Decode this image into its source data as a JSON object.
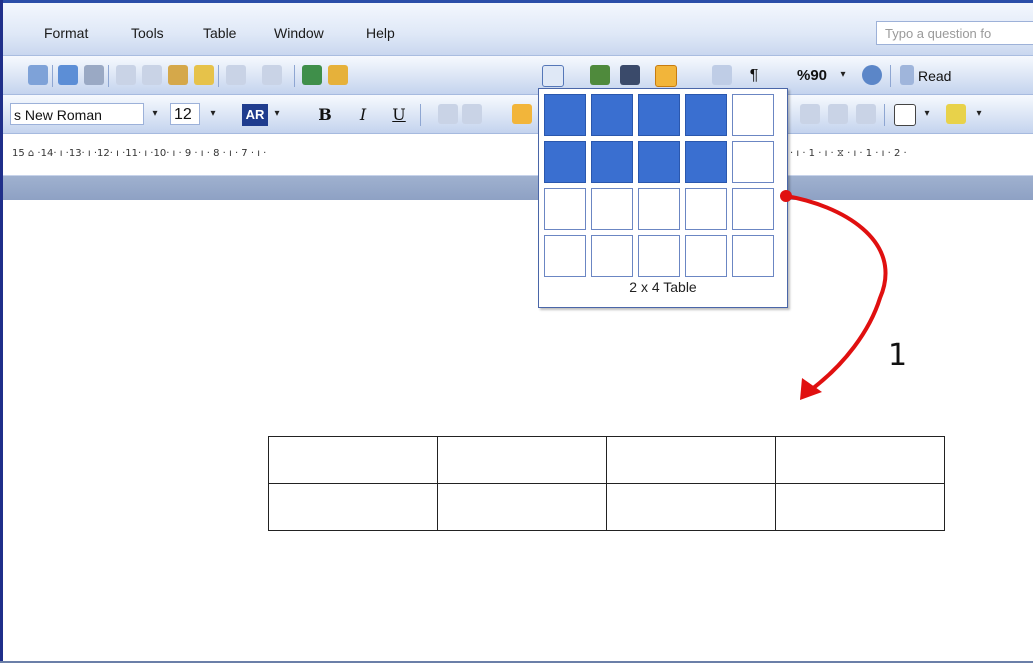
{
  "menu": {
    "items": [
      {
        "label": "Format"
      },
      {
        "label": "Tools"
      },
      {
        "label": "Table"
      },
      {
        "label": "Window"
      },
      {
        "label": "Help"
      }
    ],
    "ask_placeholder": "Typo a question fo"
  },
  "toolbar": {
    "zoom_value": "%90",
    "read_label": "Read",
    "show_marks_glyph": "¶"
  },
  "formatting": {
    "font_name": "s New Roman",
    "font_size": "12",
    "style_label": "AR",
    "bold": "B",
    "italic": "I",
    "underline": "U"
  },
  "ruler": {
    "left_text": "15 ⌂ ·14· ı ·13· ı ·12· ı ·11· ı ·10· ı · 9 · ı · 8 · ı · 7 · ı ·",
    "right_text": "· ı · 1 · ı · ⧖ · ı · 1 · ı · 2 ·"
  },
  "insert_table_grid": {
    "rows": 4,
    "cols": 5,
    "selected_rows": 2,
    "selected_cols": 4,
    "caption": "2 x 4 Table"
  },
  "document": {
    "table_rows": 2,
    "table_cols": 4
  },
  "annotation": {
    "step_number": "1",
    "arrow_color": "#e01010"
  },
  "colors": {
    "selection": "#3a6fd0",
    "toolbar_accent": "#2b4ea8"
  }
}
